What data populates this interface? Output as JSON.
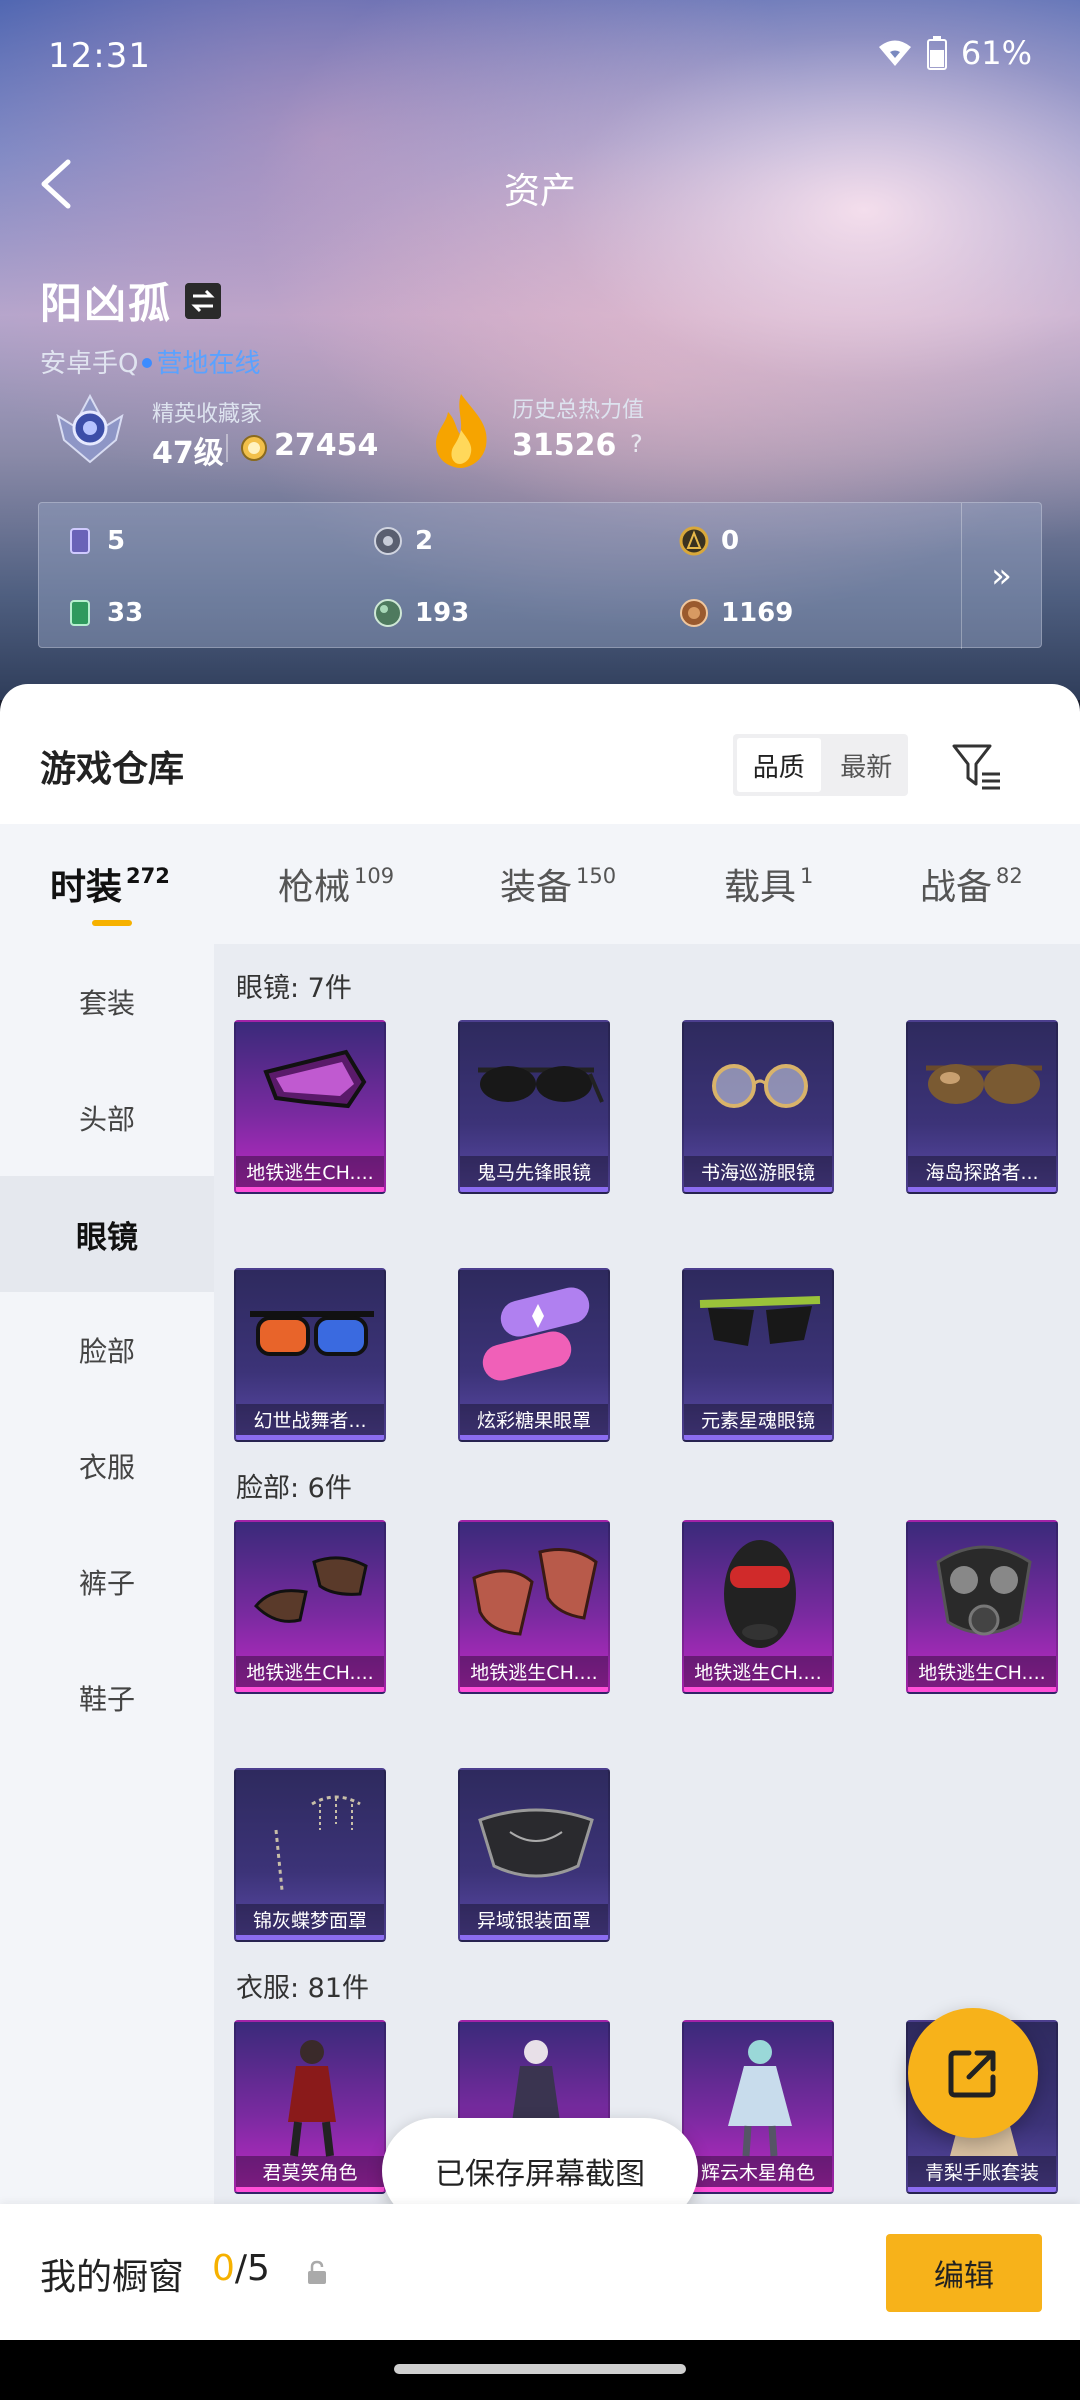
{
  "status": {
    "time": "12:31",
    "battery": "61%"
  },
  "header": {
    "title": "资产"
  },
  "profile": {
    "name": "阳凶孤",
    "platform": "安卓手Q",
    "online_status": "营地在线",
    "rank_title": "精英收藏家",
    "level": "47级",
    "coins": "27454",
    "heat_title": "历史总热力值",
    "heat_value": "31526",
    "heat_help": "?"
  },
  "currencies": [
    {
      "icon": "card-icon",
      "value": "5",
      "color": "#6a63b8"
    },
    {
      "icon": "gear-coin-icon",
      "value": "2",
      "color": "#5a5f70"
    },
    {
      "icon": "gold-emblem-icon",
      "value": "0",
      "color": "#b3862a"
    },
    {
      "icon": "green-ticket-icon",
      "value": "33",
      "color": "#2f9a5e"
    },
    {
      "icon": "green-orb-icon",
      "value": "193",
      "color": "#4e7a5e"
    },
    {
      "icon": "bronze-orb-icon",
      "value": "1169",
      "color": "#9a5a2e"
    }
  ],
  "currency_more": "»",
  "warehouse": {
    "title": "游戏仓库",
    "sort": [
      "品质",
      "最新"
    ]
  },
  "tabs": [
    {
      "label": "时装",
      "count": "272"
    },
    {
      "label": "枪械",
      "count": "109"
    },
    {
      "label": "装备",
      "count": "150"
    },
    {
      "label": "载具",
      "count": "1"
    },
    {
      "label": "战备",
      "count": "82"
    }
  ],
  "sidebar": [
    "套装",
    "头部",
    "眼镜",
    "脸部",
    "衣服",
    "裤子",
    "鞋子"
  ],
  "sections": [
    {
      "title": "眼镜: 7件",
      "items": [
        {
          "label": "地铁逃生CH....",
          "rarity": "pink"
        },
        {
          "label": "鬼马先锋眼镜",
          "rarity": "purple"
        },
        {
          "label": "书海巡游眼镜",
          "rarity": "purple"
        },
        {
          "label": "海岛探路者...",
          "rarity": "purple"
        },
        {
          "label": "幻世战舞者...",
          "rarity": "purple"
        },
        {
          "label": "炫彩糖果眼罩",
          "rarity": "purple"
        },
        {
          "label": "元素星魂眼镜",
          "rarity": "purple"
        }
      ]
    },
    {
      "title": "脸部: 6件",
      "items": [
        {
          "label": "地铁逃生CH....",
          "rarity": "pink"
        },
        {
          "label": "地铁逃生CH....",
          "rarity": "pink"
        },
        {
          "label": "地铁逃生CH....",
          "rarity": "pink"
        },
        {
          "label": "地铁逃生CH....",
          "rarity": "pink"
        },
        {
          "label": "锦灰蝶梦面罩",
          "rarity": "purple"
        },
        {
          "label": "异域银装面罩",
          "rarity": "purple"
        }
      ]
    },
    {
      "title": "衣服: 81件",
      "items": [
        {
          "label": "君莫笑角色",
          "rarity": "pink"
        },
        {
          "label": "",
          "rarity": "pink"
        },
        {
          "label": "辉云木星角色",
          "rarity": "pink"
        },
        {
          "label": "青梨手账套装",
          "rarity": "purple"
        }
      ]
    }
  ],
  "toast": "已保存屏幕截图",
  "bottom": {
    "label": "我的橱窗",
    "current": "0",
    "total": "/5",
    "edit": "编辑"
  }
}
